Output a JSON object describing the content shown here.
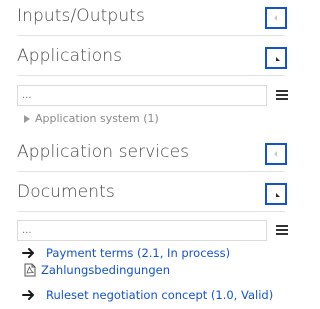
{
  "sections": [
    {
      "title": "Inputs/Outputs",
      "tile_icon": "collapse-left-icon"
    },
    {
      "title": "Applications",
      "tile_icon": "corner-fold-icon"
    },
    {
      "title": "Application services",
      "tile_icon": "collapse-left-icon"
    },
    {
      "title": "Documents",
      "tile_icon": "corner-fold-icon"
    }
  ],
  "applications": {
    "filter_placeholder": "...",
    "tree": [
      {
        "label": "Application system (1)"
      }
    ]
  },
  "documents": {
    "filter_placeholder": "...",
    "items": [
      {
        "label": "Payment terms (2.1, In process)",
        "attachment": "Zahlungsbedingungen"
      },
      {
        "label": "Ruleset negotiation concept (1.0, Valid)"
      }
    ]
  },
  "colors": {
    "accent": "#1552d0",
    "text": "#4a4a4a",
    "muted": "#8a8a8a",
    "divider": "#e3e3e3"
  }
}
